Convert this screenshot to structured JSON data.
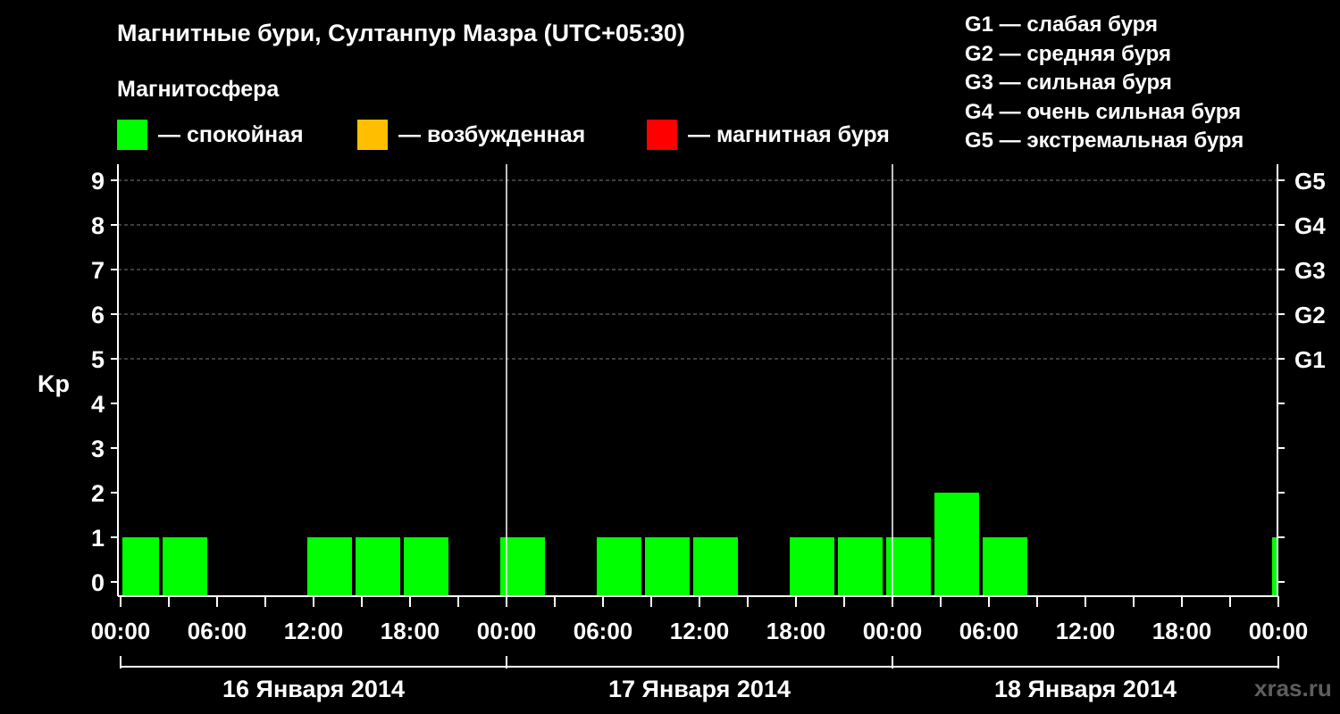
{
  "title": "Магнитные бури, Султанпур Мазра (UTC+05:30)",
  "magnetosphere": {
    "heading": "Магнитосфера",
    "items": [
      {
        "label": "— спокойная",
        "color": "#00ff00"
      },
      {
        "label": "— возбужденная",
        "color": "#ffbf00"
      },
      {
        "label": "— магнитная буря",
        "color": "#ff0000"
      }
    ]
  },
  "g_legend": [
    "G1 — слабая буря",
    "G2 — средняя буря",
    "G3 — сильная буря",
    "G4 — очень сильная буря",
    "G5 — экстремальная буря"
  ],
  "watermark": "xras.ru",
  "chart_data": {
    "type": "bar",
    "ylabel": "Kp",
    "ylim": [
      0,
      9
    ],
    "y_ticks": [
      "0",
      "1",
      "2",
      "3",
      "4",
      "5",
      "6",
      "7",
      "8",
      "9"
    ],
    "right_axis": [
      {
        "kp": 5,
        "label": "G1"
      },
      {
        "kp": 6,
        "label": "G2"
      },
      {
        "kp": 7,
        "label": "G3"
      },
      {
        "kp": 8,
        "label": "G4"
      },
      {
        "kp": 9,
        "label": "G5"
      }
    ],
    "grid": "dashed horizontal at Kp 5–9",
    "x_tick_labels": [
      "00:00",
      "06:00",
      "12:00",
      "18:00",
      "00:00",
      "06:00",
      "12:00",
      "18:00",
      "00:00",
      "06:00",
      "12:00",
      "18:00",
      "00:00"
    ],
    "days": [
      "16 Января 2014",
      "17 Января 2014",
      "18 Января 2014"
    ],
    "bar_color": "#00ff00",
    "bars": [
      {
        "start": "2014-01-16 00:00",
        "end": "2014-01-16 02:30",
        "kp": 1
      },
      {
        "start": "2014-01-16 02:30",
        "end": "2014-01-16 05:30",
        "kp": 1
      },
      {
        "start": "2014-01-16 11:30",
        "end": "2014-01-16 14:30",
        "kp": 1
      },
      {
        "start": "2014-01-16 14:30",
        "end": "2014-01-16 17:30",
        "kp": 1
      },
      {
        "start": "2014-01-16 17:30",
        "end": "2014-01-16 20:30",
        "kp": 1
      },
      {
        "start": "2014-01-16 23:30",
        "end": "2014-01-17 02:30",
        "kp": 1
      },
      {
        "start": "2014-01-17 05:30",
        "end": "2014-01-17 08:30",
        "kp": 1
      },
      {
        "start": "2014-01-17 08:30",
        "end": "2014-01-17 11:30",
        "kp": 1
      },
      {
        "start": "2014-01-17 11:30",
        "end": "2014-01-17 14:30",
        "kp": 1
      },
      {
        "start": "2014-01-17 17:30",
        "end": "2014-01-17 20:30",
        "kp": 1
      },
      {
        "start": "2014-01-17 20:30",
        "end": "2014-01-17 23:30",
        "kp": 1
      },
      {
        "start": "2014-01-17 23:30",
        "end": "2014-01-18 02:30",
        "kp": 1
      },
      {
        "start": "2014-01-18 02:30",
        "end": "2014-01-18 05:30",
        "kp": 2
      },
      {
        "start": "2014-01-18 05:30",
        "end": "2014-01-18 08:30",
        "kp": 1
      },
      {
        "start": "2014-01-18 23:30",
        "end": "2014-01-19 00:00",
        "kp": 1
      }
    ]
  }
}
